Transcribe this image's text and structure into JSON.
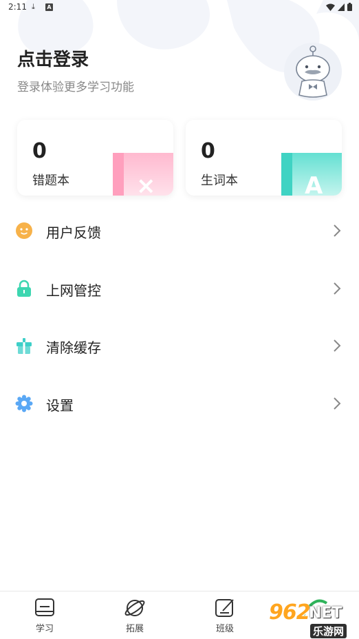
{
  "status_bar": {
    "time": "2:11",
    "download_icon": "download-icon",
    "a_icon": "A"
  },
  "header": {
    "login_title": "点击登录",
    "login_subtitle": "登录体验更多学习功能"
  },
  "cards": [
    {
      "count": "0",
      "label": "错题本",
      "glyph": "×",
      "accent": "#ffb9cf"
    },
    {
      "count": "0",
      "label": "生词本",
      "glyph": "A",
      "accent": "#64e0d2"
    }
  ],
  "menu": [
    {
      "label": "用户反馈",
      "icon": "feedback-icon",
      "color": "#f7b24a"
    },
    {
      "label": "上网管控",
      "icon": "lock-icon",
      "color": "#3dd6b0"
    },
    {
      "label": "清除缓存",
      "icon": "gift-box-icon",
      "color": "#3dcfc8"
    },
    {
      "label": "设置",
      "icon": "gear-icon",
      "color": "#5aa8f5"
    }
  ],
  "tabbar": [
    {
      "label": "学习",
      "icon": "study-icon"
    },
    {
      "label": "拓展",
      "icon": "planet-icon"
    },
    {
      "label": "班级",
      "icon": "edit-icon"
    }
  ],
  "watermark": {
    "top": "962",
    "net": "NET",
    "bottom": "乐游网"
  }
}
